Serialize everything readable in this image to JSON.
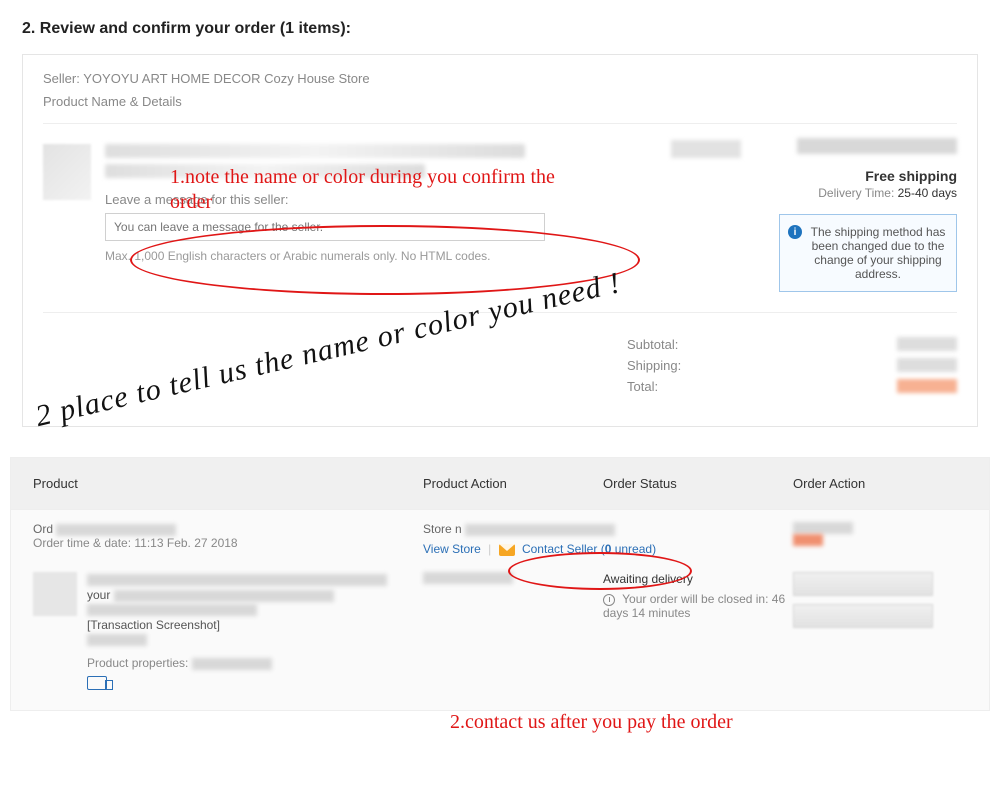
{
  "step": {
    "title": "2. Review and confirm your order (1 items):"
  },
  "seller": {
    "label": "Seller:",
    "name": "YOYOYU ART HOME DECOR Cozy House Store"
  },
  "product_details_label": "Product Name & Details",
  "message": {
    "label": "Leave a message for this seller:",
    "placeholder": "You can leave a message for the seller.",
    "help": "Max. 1,000 English characters or Arabic numerals only. No HTML codes."
  },
  "shipping": {
    "free": "Free shipping",
    "delivery_label": "Delivery Time:",
    "delivery_days": "25-40 days",
    "notice": "The shipping method has been changed due to the change of your shipping address."
  },
  "totals": {
    "subtotal_label": "Subtotal:",
    "shipping_label": "Shipping:",
    "total_label": "Total:"
  },
  "order_table": {
    "headers": {
      "product": "Product",
      "action": "Product Action",
      "status": "Order Status",
      "oaction": "Order Action"
    },
    "ord_prefix": "Ord",
    "order_time_label": "Order time & date:",
    "order_time_value": "11:13 Feb. 27 2018",
    "store_prefix": "Store n",
    "view_store": "View Store",
    "contact_seller": "Contact Seller",
    "unread_open": "(",
    "unread_n": "0",
    "unread_word": " unread)",
    "awaiting": "Awaiting delivery",
    "close_prefix": "Your order will be closed in:",
    "close_time": "46 days 14 minutes",
    "prod_your": "your",
    "prod_snapshot": "[Transaction Screenshot]",
    "prop_label": "Product properties:"
  },
  "annotations": {
    "a1": "1.note the name or color during you confirm the order",
    "a2": "2.contact us after you pay the order",
    "handwrite": "2 place to tell us the name or color you need !"
  }
}
